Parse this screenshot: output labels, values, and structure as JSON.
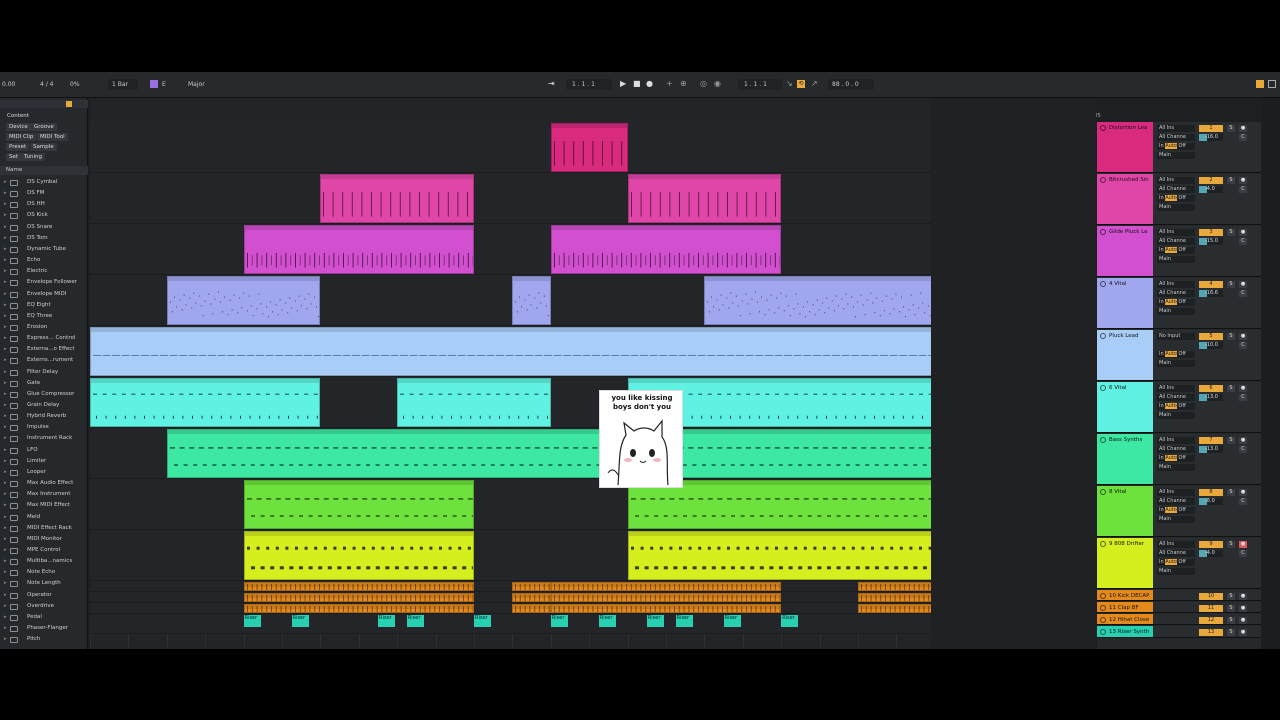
{
  "toolbar": {
    "tempo": "0.00",
    "sig": "4 / 4",
    "cpu": "0%",
    "quant": "1 Bar",
    "key": "E",
    "scale": "Major",
    "pos": "1 . 1 . 1",
    "pos2": "1 . 1 . 1",
    "loop_len": "88 . 0 . 0"
  },
  "browser": {
    "header": "Content",
    "pills": [
      "Device",
      "Groove",
      "MIDI Clip",
      "MIDI Tool",
      "Preset",
      "Sample",
      "Set",
      "Tuning"
    ],
    "name_col": "Name",
    "items": [
      "DS Cymbal",
      "DS FM",
      "DS HH",
      "DS Kick",
      "DS Snare",
      "DS Tom",
      "Dynamic Tube",
      "Echo",
      "Electric",
      "Envelope Follower",
      "Envelope MIDI",
      "EQ Eight",
      "EQ Three",
      "Erosion",
      "Express... Control",
      "Externa...o Effect",
      "Externs...rument",
      "Filter Delay",
      "Gate",
      "Glue Compressor",
      "Grain Delay",
      "Hybrid Reverb",
      "Impulse",
      "Instrument Rack",
      "LFO",
      "Limiter",
      "Looper",
      "Max Audio Effect",
      "Max Instrument",
      "Max MIDI Effect",
      "Meld",
      "MIDI Effect Rack",
      "MIDI Monitor",
      "MPE Control",
      "Multiba...namics",
      "Note Echo",
      "Note Length",
      "Operator",
      "Overdrive",
      "Pedal",
      "Phaser-Flanger",
      "Pitch"
    ]
  },
  "ruler": [
    "1",
    "5",
    "9",
    "13",
    "17",
    "21",
    "25",
    "29",
    "33",
    "37",
    "41",
    "45",
    "49",
    "53",
    "57",
    "61",
    "65",
    "69",
    "73",
    "77",
    "81",
    "85",
    "89",
    "93",
    "97",
    "101",
    "105"
  ],
  "tracks": [
    {
      "name": "Distortion Lea",
      "input": "All Ins",
      "chan": "All Channe",
      "num": "1",
      "vol": "-16.0",
      "color": "#d92a7f"
    },
    {
      "name": "Bitcrushed Sin",
      "input": "All Ins",
      "chan": "All Channe",
      "num": "2",
      "vol": "-4.0",
      "color": "#e045a8"
    },
    {
      "name": "Glide Pluck Le",
      "input": "All Ins",
      "chan": "All Channe",
      "num": "3",
      "vol": "-15.0",
      "color": "#d24fd0"
    },
    {
      "name": "4 Vital",
      "input": "All Ins",
      "chan": "All Channe",
      "num": "4",
      "vol": "-16.6",
      "color": "#a0a7ef"
    },
    {
      "name": "Pluck Lead",
      "input": "No Input",
      "chan": "",
      "num": "5",
      "vol": "-10.0",
      "color": "#a8cdf6"
    },
    {
      "name": "6 Vital",
      "input": "All Ins",
      "chan": "All Channe",
      "num": "6",
      "vol": "-13.0",
      "color": "#5ff2e2"
    },
    {
      "name": "Bass Synths",
      "input": "All Ins",
      "chan": "All Channe",
      "num": "7",
      "vol": "-13.0",
      "color": "#3de8a3"
    },
    {
      "name": "8 Vital",
      "input": "All Ins",
      "chan": "All Channe",
      "num": "8",
      "vol": "-8.0",
      "color": "#6de23c"
    },
    {
      "name": "9 808 Drifter",
      "input": "All Ins",
      "chan": "All Channe",
      "num": "9",
      "vol": "-4.0",
      "color": "#d4ee1e"
    },
    {
      "name": "10 Kick DECAP",
      "input": "",
      "chan": "",
      "num": "10",
      "vol": "",
      "color": "#e48a1c"
    },
    {
      "name": "11 Clap BF",
      "input": "",
      "chan": "",
      "num": "11",
      "vol": "",
      "color": "#e48a1c"
    },
    {
      "name": "12 Hihat Close",
      "input": "",
      "chan": "",
      "num": "12",
      "vol": "",
      "color": "#e48a1c"
    },
    {
      "name": "13 Riser Synth",
      "input": "Ext. In",
      "chan": "",
      "num": "13",
      "vol": "",
      "color": "#27d0b1"
    }
  ],
  "head_labels": {
    "main": "Main",
    "in": "In",
    "auto": "Auto",
    "off": "Off",
    "s": "S",
    "c": "C"
  },
  "riser_label": "Riser",
  "meme": {
    "caption": "you like kissing boys don't you"
  }
}
